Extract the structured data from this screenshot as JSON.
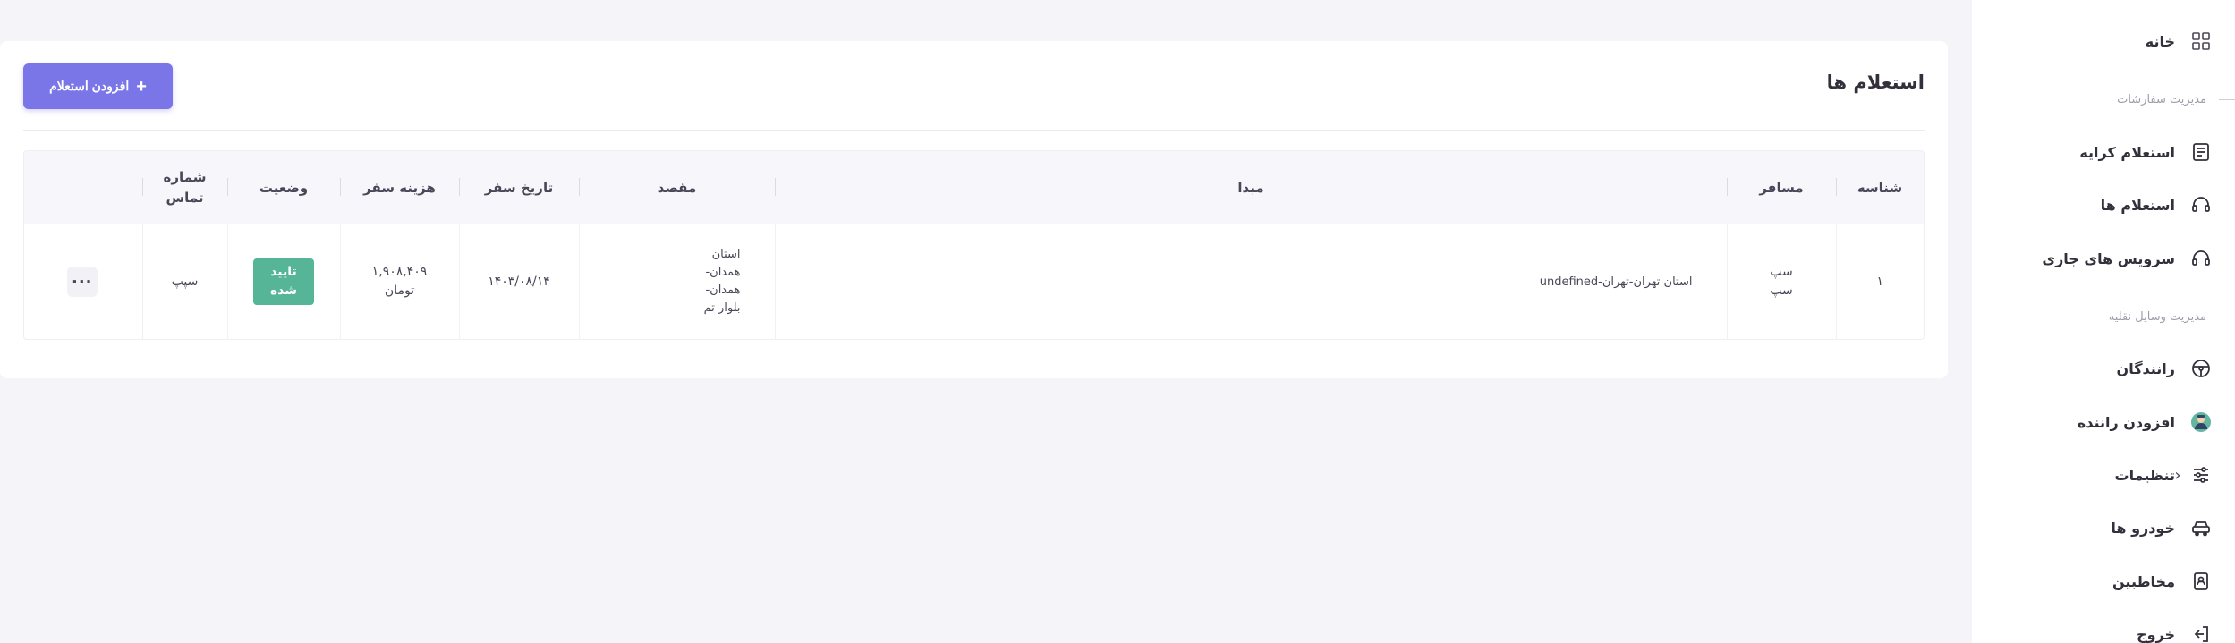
{
  "sidebar": {
    "items": [
      {
        "label": "خانه"
      },
      {
        "label": "استعلام کرایه"
      },
      {
        "label": "استعلام ها"
      },
      {
        "label": "سرویس های جاری"
      },
      {
        "label": "رانندگان"
      },
      {
        "label": "افزودن راننده"
      },
      {
        "label": "تنظیمات"
      },
      {
        "label": "خودرو ها"
      },
      {
        "label": "مخاطبین"
      },
      {
        "label": "خروج"
      }
    ],
    "sections": {
      "orders": "مدیریت سفارشات",
      "vehicles": "مدیریت وسایل نقلیه"
    }
  },
  "page": {
    "title": "استعلام ها",
    "add_button": "افزودن استعلام"
  },
  "table": {
    "headers": {
      "id": "شناسه",
      "passenger": "مسافر",
      "origin": "مبدا",
      "destination": "مقصد",
      "date": "تاریخ سفر",
      "cost": "هزینه سفر",
      "status": "وضعیت",
      "phone_line1": "شماره",
      "phone_line2": "تماس"
    },
    "rows": [
      {
        "id": "۱",
        "passenger_line1": "سپ",
        "passenger_line2": "سپ",
        "origin": "استان تهران-تهران-undefined",
        "destination_line1": "استان",
        "destination_line2": "همدان-",
        "destination_line3": "همدان-",
        "destination_line4": "بلوار تم",
        "date": "۱۴۰۳/۰۸/۱۴",
        "cost_line1": "۱,۹۰۸,۴۰۹",
        "cost_line2": "تومان",
        "status_line1": "تایید",
        "status_line2": "شده",
        "phone": "سپپ",
        "actions": "···"
      }
    ]
  },
  "colors": {
    "accent": "#7a76e8",
    "status_approved": "#56b597",
    "background": "#f5f5f9"
  }
}
